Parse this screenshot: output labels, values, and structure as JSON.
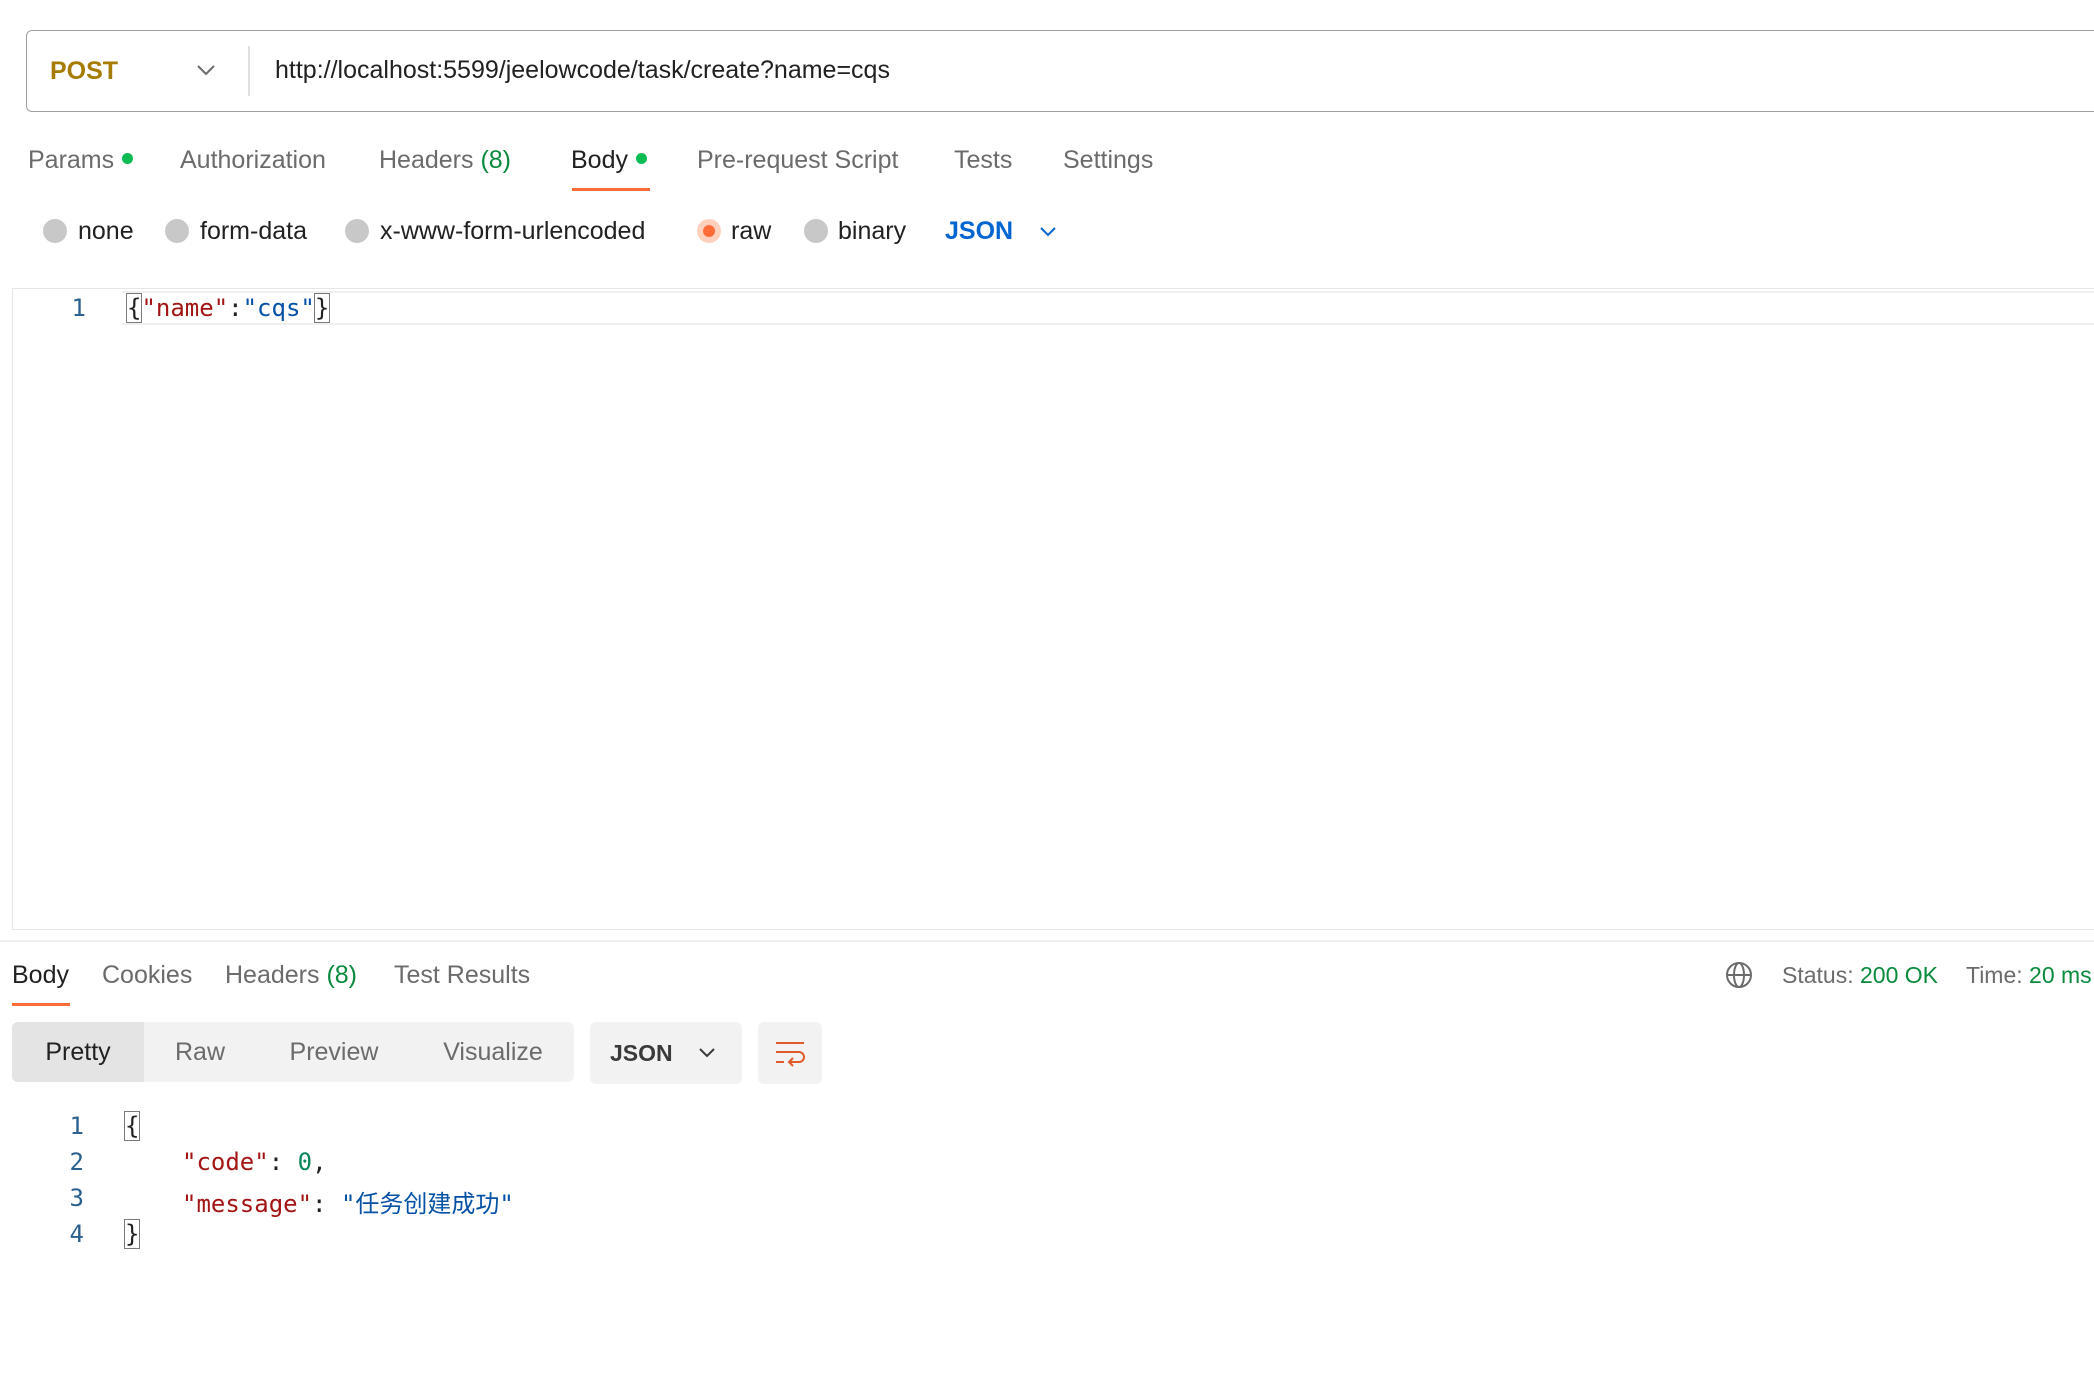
{
  "request": {
    "method": "POST",
    "url": "http://localhost:5599/jeelowcode/task/create?name=cqs",
    "tabs": [
      {
        "label": "Params",
        "dot": true
      },
      {
        "label": "Authorization"
      },
      {
        "label": "Headers",
        "count": "(8)"
      },
      {
        "label": "Body",
        "dot": true,
        "active": true
      },
      {
        "label": "Pre-request Script"
      },
      {
        "label": "Tests"
      },
      {
        "label": "Settings"
      }
    ],
    "body_types": [
      "none",
      "form-data",
      "x-www-form-urlencoded",
      "raw",
      "binary"
    ],
    "body_type_selected": "raw",
    "raw_language": "JSON",
    "editor": {
      "line_number": "1",
      "tokens": [
        "{",
        "\"name\"",
        ":",
        "\"cqs\"",
        "}"
      ]
    }
  },
  "response": {
    "tabs": [
      {
        "label": "Body",
        "active": true
      },
      {
        "label": "Cookies"
      },
      {
        "label": "Headers",
        "count": "(8)"
      },
      {
        "label": "Test Results"
      }
    ],
    "status_label": "Status:",
    "status_value": "200 OK",
    "time_label": "Time:",
    "time_value": "20 ms",
    "views": [
      "Pretty",
      "Raw",
      "Preview",
      "Visualize"
    ],
    "view_selected": "Pretty",
    "format": "JSON",
    "line_numbers": [
      "1",
      "2",
      "3",
      "4"
    ],
    "body": {
      "open": "{",
      "code_key": "\"code\"",
      "code_value": "0",
      "message_key": "\"message\"",
      "message_value": "\"任务创建成功\"",
      "close": "}"
    }
  },
  "colors": {
    "accent": "#ff6c37",
    "method": "#a67c00",
    "success": "#0a8a3c",
    "link": "#0265d2",
    "json_key": "#a31515",
    "json_string": "#0451a5",
    "json_number": "#098658"
  },
  "icons": [
    "chevron-down-icon",
    "globe-icon",
    "wrap-lines-icon"
  ]
}
